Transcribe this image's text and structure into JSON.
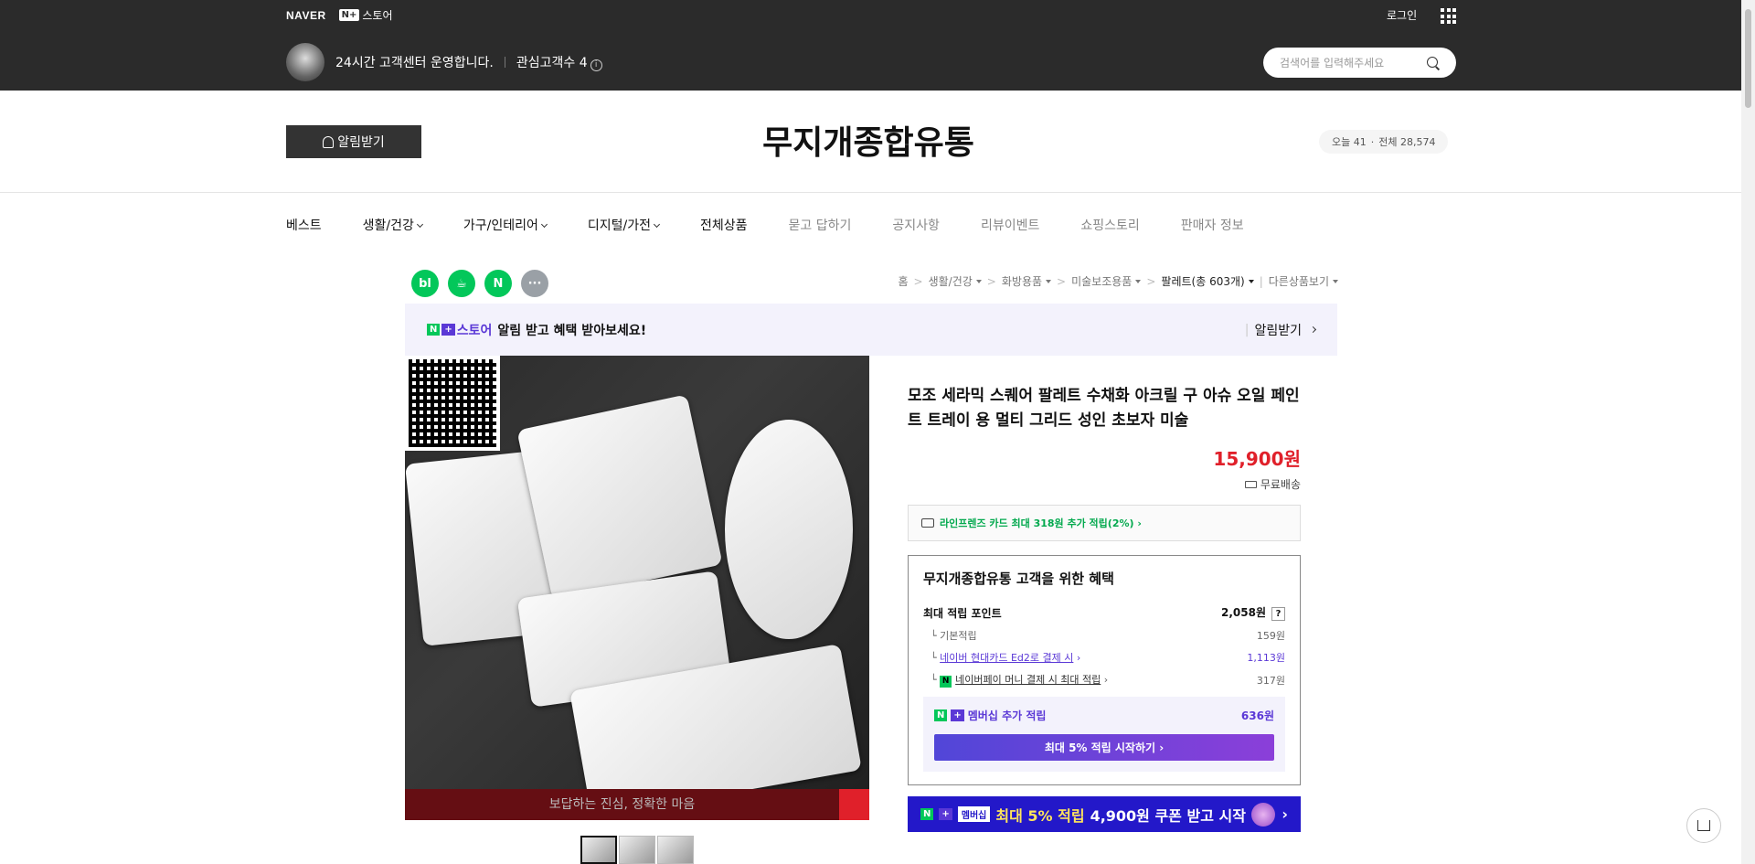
{
  "topbar": {
    "naver": "NAVER",
    "nplus_box": "N+",
    "store_label": "스토어",
    "login": "로그인",
    "cs_text": "24시간 고객센터 운영합니다.",
    "followers": "관심고객수 4",
    "search_placeholder": "검색어를 입력해주세요"
  },
  "header": {
    "alarm_button": "알림받기",
    "store_title": "무지개종합유통",
    "visit_today": "오늘 41",
    "visit_total": "전체 28,574"
  },
  "nav": {
    "items": [
      "베스트",
      "생활/건강",
      "가구/인테리어",
      "디지털/가전",
      "전체상품",
      "묻고 답하기",
      "공지사항",
      "리뷰이벤트",
      "쇼핑스토리",
      "판매자 정보"
    ]
  },
  "sns": [
    "bl",
    "☕",
    "N",
    "···"
  ],
  "breadcrumb": {
    "items": [
      "홈",
      "생활/건강",
      "화방용품",
      "미술보조용품",
      "팔레트(총 603개)",
      "다른상품보기"
    ]
  },
  "promo": {
    "store": "스토어",
    "text": "알림 받고 혜택 받아보세요!",
    "right": "알림받기"
  },
  "image": {
    "caption": "보답하는 진심, 정확한 마음"
  },
  "product": {
    "title": "모조 세라믹 스퀘어 팔레트 수채화 아크릴 구 아슈 오일 페인트 트레이 용 멀티 그리드 성인 초보자 미술",
    "price": "15,900원",
    "shipping": "무료배송",
    "card_benefit": "라인프렌즈 카드 최대 318원 추가 적립(2%) ›"
  },
  "benefit": {
    "title": "무지개종합유통 고객을 위한 혜택",
    "max_label": "최대 적립 포인트",
    "max_value": "2,058원",
    "basic_label": "기본적립",
    "basic_value": "159원",
    "card_label": "네이버 현대카드 Ed2로 결제 시",
    "card_value": "1,113원",
    "npay_label": "네이버페이 머니 결제 시 최대 적립",
    "npay_value": "317원",
    "membership_label": "멤버십 추가 적립",
    "membership_value": "636원",
    "membership_button": "최대 5% 적립 시작하기 ›"
  },
  "banner": {
    "badge": "멤버십",
    "text1": "최대 5% 적립",
    "text2": "4,900원 쿠폰 받고 시작",
    "arrow": "›"
  }
}
